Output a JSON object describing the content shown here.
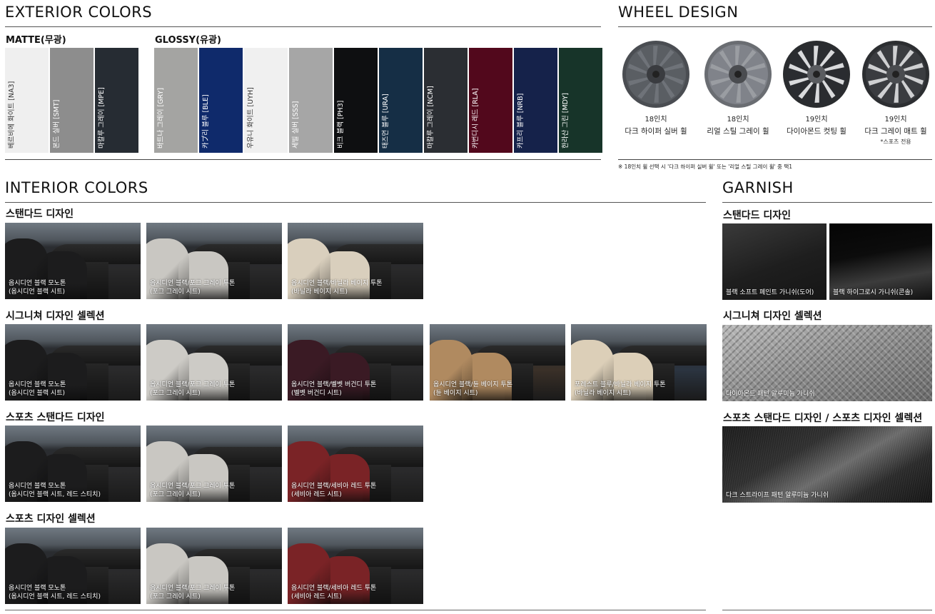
{
  "exterior": {
    "title": "EXTERIOR COLORS",
    "matte_label": "MATTE(무광)",
    "glossy_label": "GLOSSY(유광)",
    "matte": [
      {
        "name": "베르비에 화이트 [NA3]",
        "color": "#efefef",
        "text": "#333333"
      },
      {
        "name": "본드 실버 [SMT]",
        "color": "#8d8d8d",
        "text": "#ffffff"
      },
      {
        "name": "마칼루 그레이 [MPE]",
        "color": "#262c33",
        "text": "#ffffff"
      }
    ],
    "glossy": [
      {
        "name": "바트나 그레이 [GRY]",
        "color": "#a4a4a2",
        "text": "#ffffff"
      },
      {
        "name": "카プ리 블루 [BLE]",
        "color": "#0f2a6b",
        "text": "#ffffff"
      },
      {
        "name": "우유니 화이트 [UYH]",
        "color": "#f0f0f0",
        "text": "#333333"
      },
      {
        "name": "세빌 실버 [SSS]",
        "color": "#a6a6a6",
        "text": "#ffffff"
      },
      {
        "name": "비크 블랙 [PH3]",
        "color": "#0e0f11",
        "text": "#ffffff"
      },
      {
        "name": "태즈먼 블루 [URA]",
        "color": "#152e45",
        "text": "#ffffff"
      },
      {
        "name": "마칼루 그레이 [NCM]",
        "color": "#2b2e33",
        "text": "#ffffff"
      },
      {
        "name": "카번디시 레드 [RLA]",
        "color": "#52081c",
        "text": "#ffffff"
      },
      {
        "name": "카프리 블루 [NRB]",
        "color": "#15224a",
        "text": "#ffffff"
      },
      {
        "name": "한라산 그린 [MDY]",
        "color": "#173429",
        "text": "#ffffff"
      }
    ]
  },
  "wheels": {
    "title": "WHEEL DESIGN",
    "items": [
      {
        "size": "18인치",
        "name": "다크 하이퍼 실버 휠",
        "note": ""
      },
      {
        "size": "18인치",
        "name": "리얼 스틸 그레이 휠",
        "note": ""
      },
      {
        "size": "19인치",
        "name": "다이아몬드 컷팅 휠",
        "note": ""
      },
      {
        "size": "19인치",
        "name": "다크 그레이 매트 휠",
        "note": "*스포츠 전용"
      }
    ],
    "footnote": "※ 18인치 휠 선택 시 '다크 하이퍼 실버 휠' 또는 '리얼 스틸 그레이 휠' 중 택1"
  },
  "interior": {
    "title": "INTERIOR COLORS",
    "groups": [
      {
        "title": "스탠다드 디자인",
        "tiles": [
          {
            "line1": "옵시디언 블랙 모노톤",
            "line2": "(옵시디언 블랙 시트)",
            "seat": "#1c1c1d",
            "trim": "#2a2a2b"
          },
          {
            "line1": "옵시디언 블랙/포그 그레이 투톤",
            "line2": "(포그 그레이 시트)",
            "seat": "#c9c7c2",
            "trim": "#2a2a2b"
          },
          {
            "line1": "옵시디언 블랙/바닐라 베이지 투톤",
            "line2": "(바닐라 베이지 시트)",
            "seat": "#d9cfbd",
            "trim": "#2a2a2b"
          }
        ]
      },
      {
        "title": "시그니쳐 디자인 셀렉션",
        "tiles": [
          {
            "line1": "옵시디언 블랙 모노톤",
            "line2": "(옵시디언 블랙 시트)",
            "seat": "#1c1c1d",
            "trim": "#2a2a2b"
          },
          {
            "line1": "옵시디언 블랙/포그 그레이 투톤",
            "line2": "(포그 그레이 시트)",
            "seat": "#cdcbc6",
            "trim": "#2a2a2b"
          },
          {
            "line1": "옵시디언 블랙/벨벳 버건디 투톤",
            "line2": "(벨벳 버건디 시트)",
            "seat": "#3a1a24",
            "trim": "#2a2a2b"
          },
          {
            "line1": "옵시디언 블랙/듄 베이지 투톤",
            "line2": "(듄 베이지 시트)",
            "seat": "#b08a60",
            "trim": "#3a3028"
          },
          {
            "line1": "포레스트 블루/바닐라 베이지 투톤",
            "line2": "(바닐라 베이지 시트)",
            "seat": "#dccfb8",
            "trim": "#2b3440"
          }
        ]
      },
      {
        "title": "스포츠 스탠다드 디자인",
        "tiles": [
          {
            "line1": "옵시디언 블랙 모노톤",
            "line2": "(옵시디언 블랙 시트, 레드 스티치)",
            "seat": "#1c1c1d",
            "trim": "#2a2a2b"
          },
          {
            "line1": "옵시디언 블랙/포그 그레이 투톤",
            "line2": "(포그 그레이 시트)",
            "seat": "#c9c7c2",
            "trim": "#2a2a2b"
          },
          {
            "line1": "옵시디언 블랙/세비아 레드 투톤",
            "line2": "(세비아 레드 시트)",
            "seat": "#7a2326",
            "trim": "#2a2a2b"
          }
        ]
      },
      {
        "title": "스포츠 디자인 셀렉션",
        "tiles": [
          {
            "line1": "옵시디언 블랙 모노톤",
            "line2": "(옵시디언 블랙 시트, 레드 스티치)",
            "seat": "#1c1c1d",
            "trim": "#2a2a2b"
          },
          {
            "line1": "옵시디언 블랙/포그 그레이 투톤",
            "line2": "(포그 그레이 시트)",
            "seat": "#c9c7c2",
            "trim": "#2a2a2b"
          },
          {
            "line1": "옵시디언 블랙/세비아 레드 투톤",
            "line2": "(세비아 레드 시트)",
            "seat": "#7a2326",
            "trim": "#2a2a2b"
          }
        ]
      }
    ]
  },
  "garnish": {
    "title": "GARNISH",
    "standard_title": "스탠다드 디자인",
    "standard": [
      {
        "label": "블랙 소프트 페인트 가니쉬(도어)"
      },
      {
        "label": "블랙 하이그로시 가니쉬(콘솔)"
      }
    ],
    "signature_title": "시그니쳐 디자인 셀렉션",
    "signature": {
      "label": "다이아몬드 패턴 알루미늄 가니쉬"
    },
    "sports_title": "스포츠 스탠다드 디자인 / 스포츠 디자인 셀렉션",
    "sports": {
      "label": "다크 스트라이프 패턴 알루미늄 가니쉬"
    }
  }
}
